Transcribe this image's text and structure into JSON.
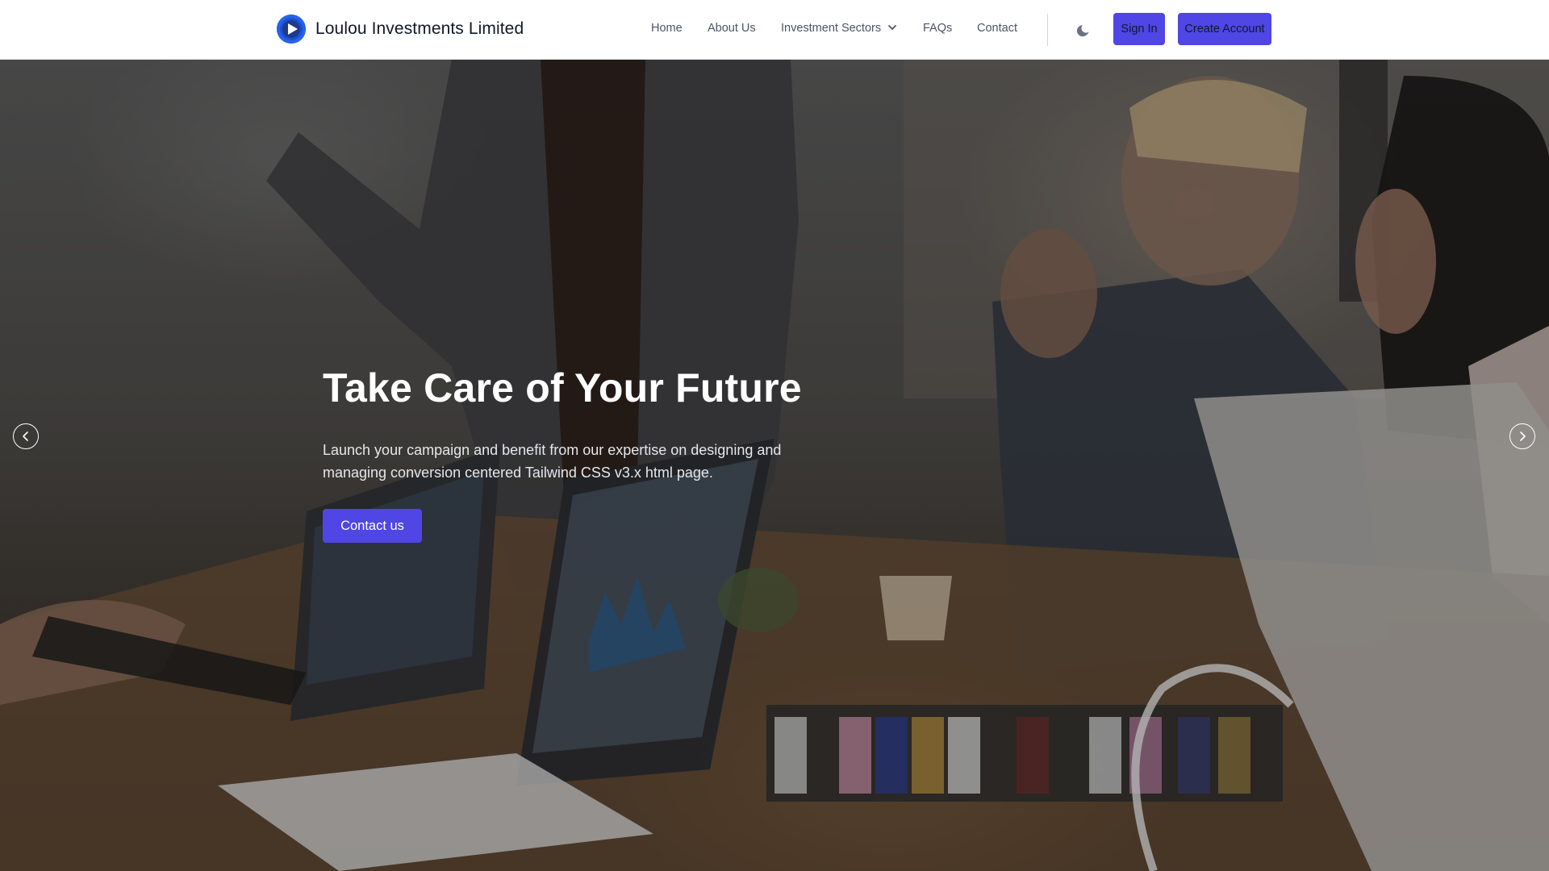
{
  "header": {
    "brand_name": "Loulou Investments Limited",
    "logo_icon": "play-circle-logo",
    "nav": [
      {
        "label": "Home"
      },
      {
        "label": "About Us"
      },
      {
        "label": "Investment Sectors",
        "has_dropdown": true
      },
      {
        "label": "FAQs"
      },
      {
        "label": "Contact"
      }
    ],
    "theme_toggle_icon": "moon-icon",
    "sign_in_label": "Sign In",
    "create_account_label": "Create Account"
  },
  "hero": {
    "title": "Take Care of Your Future",
    "subtitle": "Launch your campaign and benefit from our expertise on designing and managing conversion centered Tailwind CSS v3.x html page.",
    "cta_label": "Contact us",
    "prev_icon": "chevron-left-icon",
    "next_icon": "chevron-right-icon"
  },
  "colors": {
    "accent": "#4f46e5",
    "logo_blue": "#1d4ed8",
    "header_bg": "#ffffff",
    "nav_text": "#4b5563"
  }
}
